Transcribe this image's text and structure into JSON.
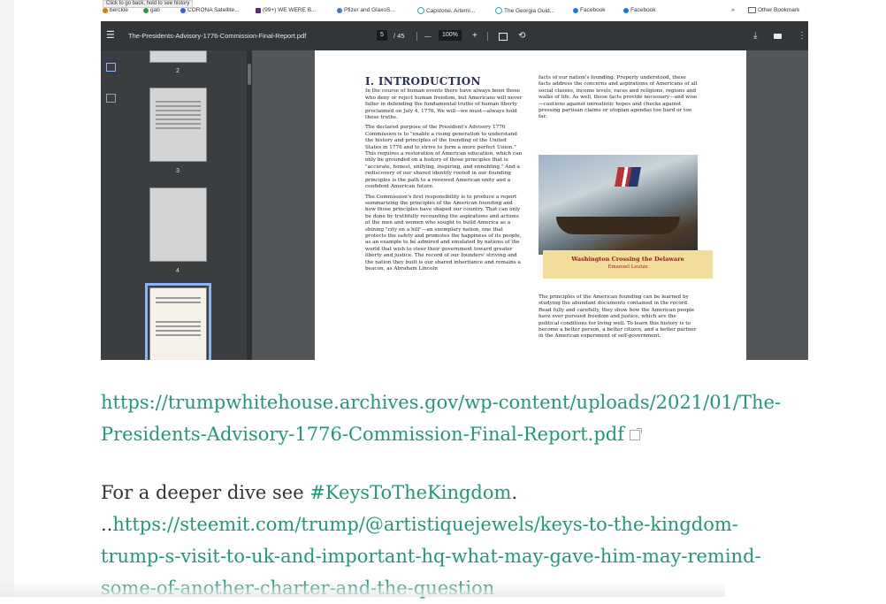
{
  "embedded_screenshot": {
    "tooltip": "Click to go back, hold to see history",
    "bookmarks": [
      "berckle",
      "gab",
      "CORONA Satellite...",
      "(99+) WE WERE B...",
      "Pfizer and GlaxoS...",
      "Capstone, Artemi...",
      "The Georgia Guid...",
      "Facebook",
      "Facebook"
    ],
    "bookmarks_more": "»",
    "other_bookmarks": "Other Bookmark",
    "pdf_toolbar": {
      "menu_icon": "menu-icon",
      "filename": "The-Presidents-Advisory-1776-Commission-Final-Report.pdf",
      "current_page": "5",
      "total_pages": "/ 45",
      "zoom_out": "—",
      "zoom": "100%",
      "zoom_in": "+",
      "download_icon": "download-icon",
      "print_icon": "print-icon",
      "more_icon": "more-vert-icon"
    },
    "thumbnails": [
      {
        "page": "2"
      },
      {
        "page": "3"
      },
      {
        "page": "4"
      }
    ],
    "page": {
      "heading": "I.    INTRODUCTION",
      "left_paragraphs": [
        "In the course of human events there have always been those who deny or reject human freedom, but Americans will never falter in defending the fundamental truths of human liberty proclaimed on July 4, 1776. We will—we must—always hold these truths.",
        "The declared purpose of the President's Advisory 1776 Commission is to \"enable a rising generation to understand the history and principles of the founding of the United States in 1776 and to strive to form a more perfect Union.\" This requires a restoration of American education, which can only be grounded on a history of those principles that is \"accurate, honest, unifying, inspiring, and ennobling.\" And a rediscovery of our shared identity rooted in our founding principles is the path to a renewed American unity and a confident American future.",
        "The Commission's first responsibility is to produce a report summarizing the principles of the American founding and how those principles have shaped our country. That can only be done by truthfully recounting the aspirations and actions of the men and women who sought to build America as a shining \"city on a hill\"—an exemplary nation, one that protects the safety and promotes the happiness of its people, as an example to be admired and emulated by nations of the world that wish to steer their government toward greater liberty and justice. The record of our founders' striving and the nation they built is our shared inheritance and remains a beacon, as Abraham Lincoln"
      ],
      "right_paragraph_top": "facts of our nation's founding. Properly understood, these facts address the concerns and aspirations of Americans of all social classes, income levels, races and religions, regions and walks of life. As well, these facts provide necessary—and wise—cautions against unrealistic hopes and checks against pressing partisan claims or utopian agendas too hard or too far.",
      "caption_title": "Washington Crossing the Delaware",
      "caption_artist": "Emanuel Leutze",
      "right_paragraph_bottom": "The principles of the American founding can be learned by studying the abundant documents contained in the record. Read fully and carefully, they show how the American people have ever pursued freedom and justice, which are the political conditions for living well. To learn this history is to become a better person, a better citizen, and a better partner in the American experiment of self-government."
    }
  },
  "article": {
    "pdf_link_line1": "https://trumpwhitehouse.archives.gov/wp-content/uploads/2021/01/The-",
    "pdf_link_line2": "Presidents-Advisory-1776-Commission-Final-Report.pdf",
    "external_icon": "external-link-icon",
    "deeper_prefix": "For a deeper dive see ",
    "hashtag": "#KeysToTheKingdom",
    "deeper_suffix": ".",
    "dots": "..",
    "steemit_line1": "https://steemit.com/trump/@artistiquejewels/keys-to-the-kingdom-",
    "steemit_line2": "trump-s-visit-to-uk-and-important-hq-what-may-gave-him-may-remind-",
    "steemit_line3": "some-of-another-charter-and-the-question"
  },
  "colors": {
    "link": "#1b9b79",
    "body_text": "#333333",
    "pdf_toolbar": "#323639",
    "pdf_background": "#525659",
    "caption_bg": "#f3dd9b"
  }
}
